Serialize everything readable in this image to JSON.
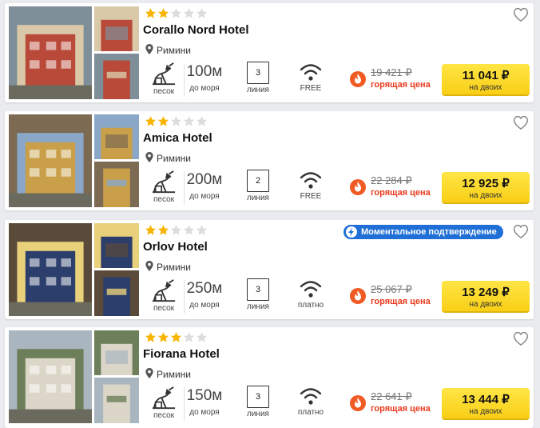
{
  "currency_note": "на двоих",
  "labels": {
    "sand": "песок",
    "to_sea": "до моря",
    "line": "линия",
    "hot_price": "горящая цена",
    "instant_confirm": "Моментальное подтверждение"
  },
  "colors": {
    "star_filled": "#f8b400",
    "star_empty": "#dcdcdc",
    "hot": "#e8391c",
    "buy_button": "#fddd2a",
    "instant_badge": "#1f6fd6"
  },
  "hotels": [
    {
      "name": "Corallo Nord Hotel",
      "stars": 2,
      "stars_max": 5,
      "location": "Римини",
      "beach": "песок",
      "distance": "100м",
      "line": "3",
      "wifi": "FREE",
      "old_price": "19 421 ₽",
      "price": "11 041 ₽",
      "instant": false
    },
    {
      "name": "Amica Hotel",
      "stars": 2,
      "stars_max": 5,
      "location": "Римини",
      "beach": "песок",
      "distance": "200м",
      "line": "2",
      "wifi": "FREE",
      "old_price": "22 284 ₽",
      "price": "12 925 ₽",
      "instant": false
    },
    {
      "name": "Orlov Hotel",
      "stars": 2,
      "stars_max": 5,
      "location": "Римини",
      "beach": "песок",
      "distance": "250м",
      "line": "3",
      "wifi": "платно",
      "old_price": "25 067 ₽",
      "price": "13 249 ₽",
      "instant": true
    },
    {
      "name": "Fiorana Hotel",
      "stars": 3,
      "stars_max": 5,
      "location": "Римини",
      "beach": "песок",
      "distance": "150м",
      "line": "3",
      "wifi": "платно",
      "old_price": "22 641 ₽",
      "price": "13 444 ₽",
      "instant": false
    }
  ]
}
